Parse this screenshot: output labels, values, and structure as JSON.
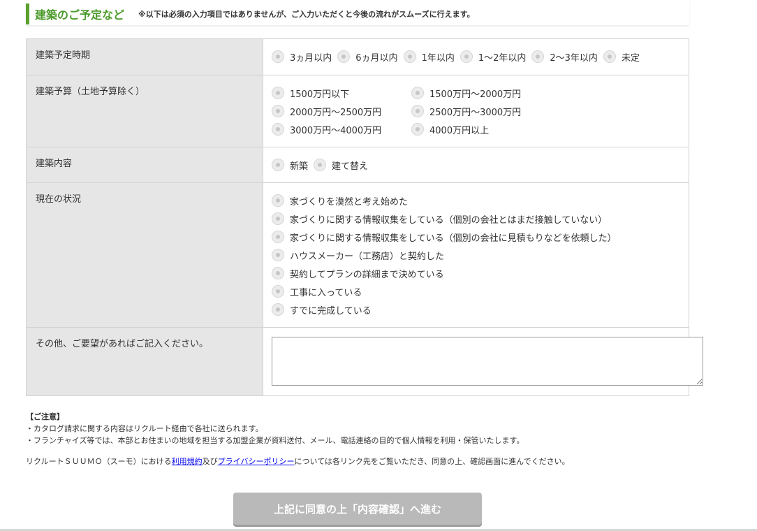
{
  "section": {
    "title": "建築のご予定など",
    "note": "※以下は必須の入力項目ではありませんが、ご入力いただくと今後の流れがスムーズに行えます。"
  },
  "rows": {
    "timing": {
      "label": "建築予定時期",
      "options": [
        "3ヵ月以内",
        "6ヵ月以内",
        "1年以内",
        "1〜2年以内",
        "2〜3年以内",
        "未定"
      ]
    },
    "budget": {
      "label": "建築予算（土地予算除く）",
      "options": [
        "1500万円以下",
        "1500万円〜2000万円",
        "2000万円〜2500万円",
        "2500万円〜3000万円",
        "3000万円〜4000万円",
        "4000万円以上"
      ]
    },
    "content": {
      "label": "建築内容",
      "options": [
        "新築",
        "建て替え"
      ]
    },
    "status": {
      "label": "現在の状況",
      "options": [
        "家づくりを漠然と考え始めた",
        "家づくりに関する情報収集をしている（個別の会社とはまだ接触していない）",
        "家づくりに関する情報収集をしている（個別の会社に見積もりなどを依頼した）",
        "ハウスメーカー（工務店）と契約した",
        "契約してプランの詳細まで決めている",
        "工事に入っている",
        "すでに完成している"
      ]
    },
    "requests": {
      "label": "その他、ご要望があればご記入ください。",
      "value": ""
    }
  },
  "notes": {
    "title": "【ご注意】",
    "lines": [
      "・カタログ請求に関する内容はリクルート経由で各社に送られます。",
      "・フランチャイズ等では、本部とお住まいの地域を担当する加盟企業が資料送付、メール、電話連絡の目的で個人情報を利用・保管いたします。"
    ]
  },
  "agreement": {
    "prefix": "リクルートＳＵＵＭＯ（スーモ）における",
    "terms_link": "利用規約",
    "middle": "及び",
    "privacy_link": "プライバシーポリシー",
    "suffix": "については各リンク先をご覧いただき、同意の上、確認画面に進んでください。"
  },
  "submit_label": "上記に同意の上「内容確認」へ進む",
  "colors": {
    "accent": "#5aa02c",
    "header_cell": "#e6e6e6",
    "button": "#b9b9b9"
  }
}
